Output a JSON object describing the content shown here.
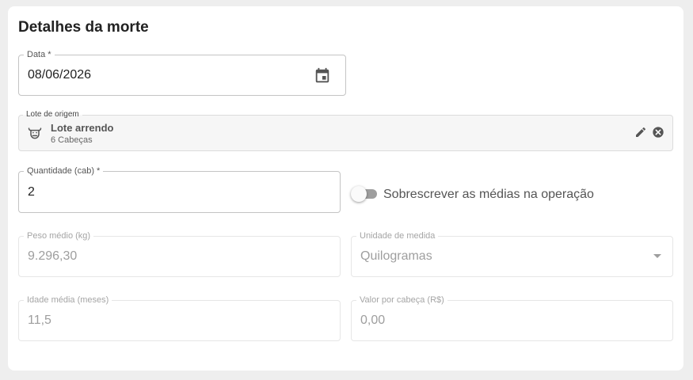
{
  "card": {
    "title": "Detalhes da morte"
  },
  "data_field": {
    "label": "Data *",
    "value": "08/06/2026"
  },
  "lote_field": {
    "label": "Lote de origem",
    "name": "Lote arrendo",
    "subtitle": "6 Cabeças"
  },
  "quantidade_field": {
    "label": "Quantidade (cab) *",
    "value": "2"
  },
  "toggle": {
    "label": "Sobrescrever as médias na operação",
    "checked": false
  },
  "peso_field": {
    "label": "Peso médio (kg)",
    "value": "9.296,30"
  },
  "unidade_field": {
    "label": "Unidade de medida",
    "value": "Quilogramas"
  },
  "idade_field": {
    "label": "Idade média (meses)",
    "value": "11,5"
  },
  "valor_field": {
    "label": "Valor por cabeça (R$)",
    "value": "0,00"
  },
  "colors": {
    "border": "#c4c4c4",
    "disabled_text": "#9e9e9e",
    "toggle_off": "#9e9e9e"
  }
}
